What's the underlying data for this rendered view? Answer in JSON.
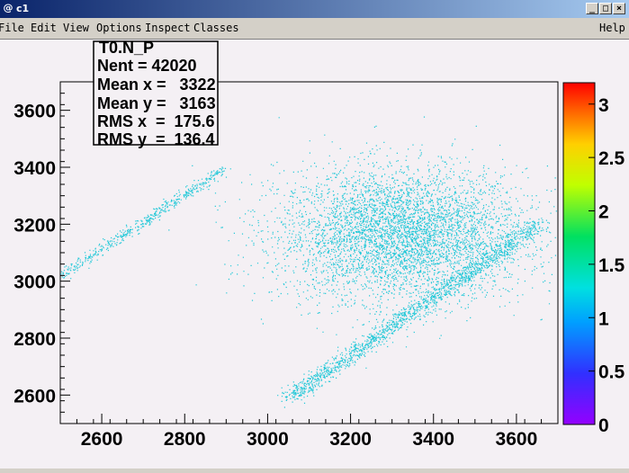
{
  "window": {
    "title": "c1",
    "icon": "root-icon",
    "controls": [
      "_",
      "□",
      "×"
    ]
  },
  "menu": {
    "left": [
      "File",
      "Edit",
      "View",
      "Options",
      "Inspect",
      "Classes"
    ],
    "right": "Help"
  },
  "stats": {
    "name": "T0.N_P",
    "lines": [
      "Nent = 42020",
      "Mean x =   3322",
      "Mean y =   3163",
      "RMS x  =  175.6",
      "RMS y  =  136.4"
    ]
  },
  "chart_data": {
    "type": "scatter",
    "title": "",
    "xlabel": "",
    "ylabel": "",
    "xlim": [
      2500,
      3700
    ],
    "ylim": [
      2500,
      3700
    ],
    "x_ticks": [
      2600,
      2800,
      3000,
      3200,
      3400,
      3600
    ],
    "y_ticks": [
      2600,
      2800,
      3000,
      3200,
      3400,
      3600
    ],
    "colorbar": {
      "range": [
        0,
        3.2
      ],
      "ticks": [
        "0",
        "0.5",
        "1",
        "1.5",
        "2",
        "2.5",
        "3"
      ]
    },
    "point_color": "#22c8d8",
    "clusters": [
      {
        "name": "main",
        "center": [
          3322,
          3163
        ],
        "spread": [
          175.6,
          136.4
        ]
      },
      {
        "name": "upper-left band",
        "from": [
          2500,
          3020
        ],
        "to": [
          2900,
          3400
        ]
      },
      {
        "name": "lower band",
        "from": [
          3050,
          2590
        ],
        "to": [
          3650,
          3200
        ]
      }
    ]
  },
  "colors": {
    "titlebar_start": "#0a246a",
    "titlebar_end": "#a6caf0",
    "canvas_bg": "#f4f0f4",
    "frame_bg": "#d4d0c8"
  }
}
